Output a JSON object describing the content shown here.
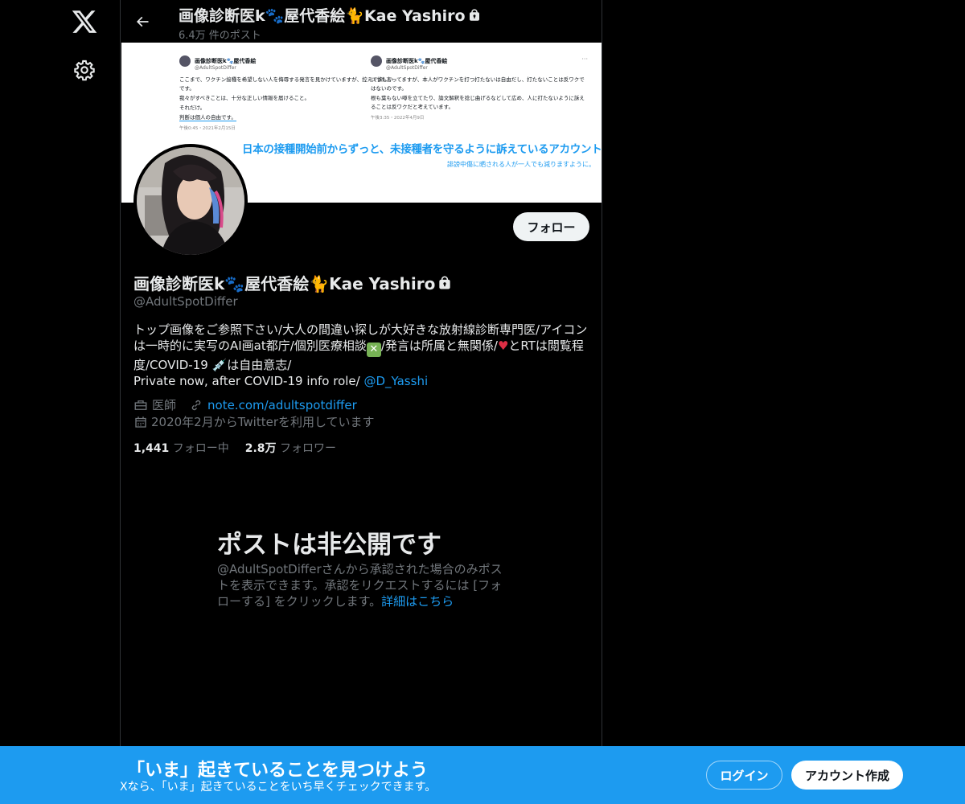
{
  "header": {
    "display_name": "画像診断医k🐾屋代香絵🐈Kae Yashiro",
    "post_count": "6.4万 件のポスト"
  },
  "banner": {
    "left_tweet": {
      "name": "画像診断医k🐾屋代香絵",
      "handle": "@AdultSpotDiffer",
      "lines": [
        "ここまで、ワクチン接種を希望しない人を侮辱する発言を見かけていますが、控えて欲しいです。",
        "我々がすべきことは、十分な正しい情報を届けること。",
        "それだけ。",
        "判断は個人の自由です。"
      ],
      "timestamp": "午後0:45・2021年2月15日"
    },
    "right_tweet": {
      "name": "画像診断医k🐾屋代香絵",
      "handle": "@AdultSpotDiffer",
      "lines": [
        "いつも言ってますが、本人がワクチンを打つ打たないは自由だし、打たないことは反ワクではないのです。",
        "根も葉もない噂を立てたり、論文解釈を捻じ曲げるなどして広め、人に打たないように訴えることは反ワクだと考えています。"
      ],
      "timestamp": "午後3:35・2022年4月9日"
    },
    "headline": "日本の接種開始前からずっと、未接種者を守るように訴えているアカウントです。",
    "subline": "誹謗中傷に晒される人が一人でも減りますように。"
  },
  "profile": {
    "follow_label": "フォロー",
    "name": "画像診断医k🐾屋代香絵🐈Kae Yashiro",
    "handle": "@AdultSpotDiffer",
    "bio_line1": "トップ画像をご参照下さい/大人の間違い探しが大好きな放射線診断専門医/アイコンは一時的に実写のAI画at都庁/個別医療相談",
    "bio_line1b": "/発言は所属と無関係/",
    "bio_line1c": "とRTは閲覧程度/COVID-19 💉は自由意志/",
    "bio_line2": "Private now, after COVID-19 info role/ ",
    "bio_link": "@D_Yasshi",
    "profession": "医師",
    "website": "note.com/adultspotdiffer",
    "joined": "2020年2月からTwitterを利用しています",
    "following_count": "1,441",
    "following_label": "フォロー中",
    "followers_count": "2.8万",
    "followers_label": "フォロワー"
  },
  "private_notice": {
    "title": "ポストは非公開です",
    "desc": "@AdultSpotDifferさんから承認された場合のみポストを表示できます。承認をリクエストするには [フォローする] をクリックします。",
    "link": "詳細はこちら"
  },
  "bottom_bar": {
    "title": "「いま」起きていることを見つけよう",
    "subtitle": "Xなら、「いま」起きていることをいち早くチェックできます。",
    "login_label": "ログイン",
    "signup_label": "アカウント作成"
  },
  "colors": {
    "accent": "#1d9bf0",
    "background": "#000000",
    "muted_text": "#71767b",
    "border": "#2f3336"
  },
  "icons": [
    "x-logo-icon",
    "gear-icon",
    "back-arrow-icon",
    "lock-icon",
    "briefcase-icon",
    "link-icon",
    "calendar-icon"
  ]
}
